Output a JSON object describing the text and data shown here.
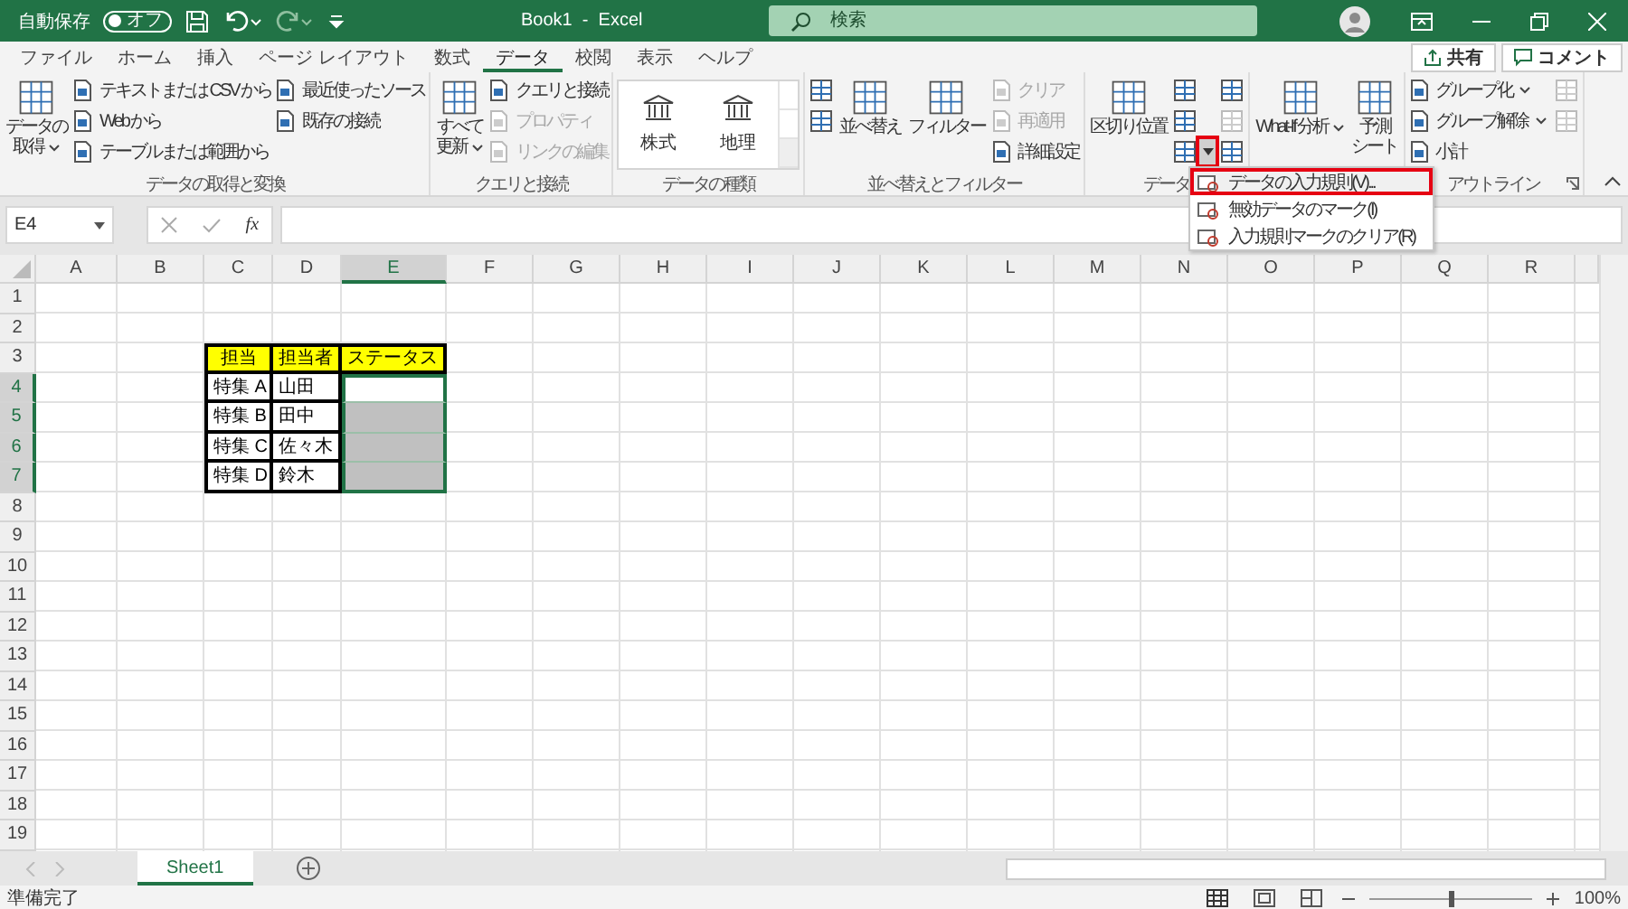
{
  "title_bar": {
    "autosave_label": "自動保存",
    "autosave": {
      "on": false,
      "label": "オフ"
    },
    "document_title": "Book1  -  Excel",
    "search": {
      "placeholder": "検索"
    }
  },
  "tabs": [
    {
      "label": "ファイル",
      "selected": false
    },
    {
      "label": "ホーム",
      "selected": false
    },
    {
      "label": "挿入",
      "selected": false
    },
    {
      "label": "ページ レイアウト",
      "selected": false
    },
    {
      "label": "数式",
      "selected": false
    },
    {
      "label": "データ",
      "selected": true
    },
    {
      "label": "校閲",
      "selected": false
    },
    {
      "label": "表示",
      "selected": false
    },
    {
      "label": "ヘルプ",
      "selected": false
    }
  ],
  "share_button": {
    "label": "共有"
  },
  "comment_button": {
    "label": "コメント"
  },
  "ribbon_groups": [
    {
      "label": "データの取得と変換",
      "items": [
        {
          "kind": "large",
          "lines": [
            "データの",
            "取得"
          ],
          "dropdown": true
        },
        {
          "kind": "stack",
          "buttons": [
            {
              "label": "テキストまたは CSV から",
              "disabled": false
            },
            {
              "label": "Web から",
              "disabled": false
            },
            {
              "label": "テーブルまたは範囲から",
              "disabled": false
            }
          ]
        },
        {
          "kind": "stack",
          "buttons": [
            {
              "label": "最近使ったソース",
              "disabled": false
            },
            {
              "label": "既存の接続",
              "disabled": false
            }
          ]
        }
      ]
    },
    {
      "label": "クエリと接続",
      "items": [
        {
          "kind": "large",
          "lines": [
            "すべて",
            "更新"
          ],
          "dropdown": true
        },
        {
          "kind": "stack",
          "buttons": [
            {
              "label": "クエリと接続",
              "disabled": false
            },
            {
              "label": "プロパティ",
              "disabled": true
            },
            {
              "label": "リンクの編集",
              "disabled": true
            }
          ]
        }
      ]
    },
    {
      "label": "データの種類",
      "items": [
        {
          "kind": "gallery",
          "entries": [
            "株式",
            "地理"
          ]
        }
      ]
    },
    {
      "label": "並べ替えとフィルター",
      "items": [
        {
          "kind": "icon_stack",
          "buttons": [
            {
              "disabled": false
            },
            {
              "disabled": false
            }
          ]
        },
        {
          "kind": "large",
          "lines": [
            "並べ替え"
          ],
          "dropdown": false
        },
        {
          "kind": "large",
          "lines": [
            "フィルター"
          ],
          "dropdown": false
        },
        {
          "kind": "stack",
          "buttons": [
            {
              "label": "クリア",
              "disabled": true
            },
            {
              "label": "再適用",
              "disabled": true
            },
            {
              "label": "詳細設定",
              "disabled": false
            }
          ]
        }
      ]
    },
    {
      "label": "データ",
      "items": [
        {
          "kind": "large",
          "lines": [
            "区切り位置"
          ],
          "dropdown": false
        },
        {
          "kind": "icon_stack",
          "buttons": [
            {
              "disabled": false
            },
            {
              "disabled": false
            },
            {
              "disabled": false,
              "opens_menu": true,
              "highlighted": true
            }
          ]
        },
        {
          "kind": "icon_stack",
          "buttons": [
            {
              "disabled": false
            },
            {
              "disabled": true
            },
            {
              "disabled": false
            }
          ]
        }
      ]
    },
    {
      "items": [
        {
          "kind": "large",
          "lines": [
            "What-If 分析"
          ],
          "dropdown": true
        },
        {
          "kind": "large",
          "lines": [
            "予測",
            "シート"
          ],
          "dropdown": false
        }
      ]
    },
    {
      "label": "アウトライン",
      "launcher": true,
      "items": [
        {
          "kind": "stack",
          "buttons": [
            {
              "label": "グループ化",
              "disabled": false,
              "dropdown": true
            },
            {
              "label": "グループ解除",
              "disabled": false,
              "dropdown": true
            },
            {
              "label": "小計",
              "disabled": false
            }
          ]
        },
        {
          "kind": "icon_stack",
          "buttons": [
            {
              "disabled": true
            },
            {
              "disabled": true
            }
          ]
        }
      ]
    }
  ],
  "dropdown_menu": [
    {
      "label": "データの入力規則(V)...",
      "highlighted": true
    },
    {
      "label": "無効データのマーク(I)",
      "highlighted": false
    },
    {
      "label": "入力規則マークのクリア(R)",
      "highlighted": false
    }
  ],
  "formula_bar": {
    "name_box": "E4",
    "function_label": "fx"
  },
  "grid": {
    "columns": [
      {
        "label": "A",
        "selected": false
      },
      {
        "label": "B",
        "selected": false
      },
      {
        "label": "C",
        "selected": false
      },
      {
        "label": "D",
        "selected": false
      },
      {
        "label": "E",
        "selected": true
      },
      {
        "label": "F",
        "selected": false
      },
      {
        "label": "G",
        "selected": false
      },
      {
        "label": "H",
        "selected": false
      },
      {
        "label": "I",
        "selected": false
      },
      {
        "label": "J",
        "selected": false
      },
      {
        "label": "K",
        "selected": false
      },
      {
        "label": "L",
        "selected": false
      },
      {
        "label": "M",
        "selected": false
      },
      {
        "label": "N",
        "selected": false
      },
      {
        "label": "O",
        "selected": false
      },
      {
        "label": "P",
        "selected": false
      },
      {
        "label": "Q",
        "selected": false
      },
      {
        "label": "R",
        "selected": false
      }
    ],
    "rows": [
      {
        "label": "1",
        "selected": false
      },
      {
        "label": "2",
        "selected": false
      },
      {
        "label": "3",
        "selected": false
      },
      {
        "label": "4",
        "selected": true
      },
      {
        "label": "5",
        "selected": true
      },
      {
        "label": "6",
        "selected": true
      },
      {
        "label": "7",
        "selected": true
      },
      {
        "label": "8",
        "selected": false
      },
      {
        "label": "9",
        "selected": false
      },
      {
        "label": "10",
        "selected": false
      },
      {
        "label": "11",
        "selected": false
      },
      {
        "label": "12",
        "selected": false
      },
      {
        "label": "13",
        "selected": false
      },
      {
        "label": "14",
        "selected": false
      },
      {
        "label": "15",
        "selected": false
      },
      {
        "label": "16",
        "selected": false
      },
      {
        "label": "17",
        "selected": false
      },
      {
        "label": "18",
        "selected": false
      },
      {
        "label": "19",
        "selected": false
      }
    ]
  },
  "table": {
    "header": [
      "担当",
      "担当者",
      "ステータス"
    ],
    "rows": [
      {
        "topic": "特集 A",
        "owner": "山田",
        "status_shaded": false
      },
      {
        "topic": "特集 B",
        "owner": "田中",
        "status_shaded": true
      },
      {
        "topic": "特集 C",
        "owner": "佐々木",
        "status_shaded": true
      },
      {
        "topic": "特集 D",
        "owner": "鈴木",
        "status_shaded": true
      }
    ]
  },
  "sheets": [
    {
      "label": "Sheet1",
      "selected": true
    }
  ],
  "status_bar": {
    "status": "準備完了",
    "zoom": {
      "label": "100%",
      "level": 0.5
    }
  }
}
